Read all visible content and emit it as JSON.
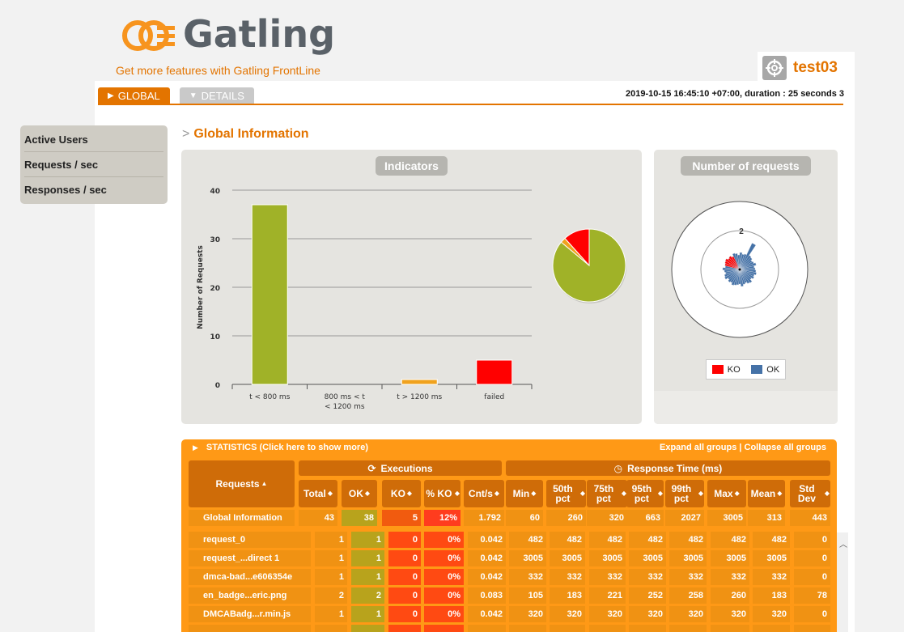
{
  "brand": {
    "name": "Gatling",
    "frontline_link": "Get more features with Gatling FrontLine"
  },
  "simulation": {
    "name": "test03",
    "icon": "crosshair-icon"
  },
  "tabs": [
    {
      "label": "GLOBAL",
      "active": true
    },
    {
      "label": "DETAILS",
      "active": false
    }
  ],
  "run_info": "2019-10-15 16:45:10 +07:00, duration : 25 seconds 3",
  "sidebar": {
    "items": [
      "Active Users",
      "Requests / sec",
      "Responses / sec"
    ]
  },
  "section_title": "Global Information",
  "indicators_panel": {
    "title": "Indicators"
  },
  "requests_panel": {
    "title": "Number of requests"
  },
  "chart_data": [
    {
      "type": "bar",
      "title": "Indicators",
      "ylabel": "Number of Requests",
      "categories": [
        "t < 800 ms",
        "800 ms < t < 1200 ms",
        "t > 1200 ms",
        "failed"
      ],
      "values": [
        37,
        0,
        1,
        5
      ],
      "colors": [
        "#a0b228",
        "#ffdd00",
        "#f0a21e",
        "#ff0000"
      ],
      "ylim": [
        0,
        40
      ],
      "yticks": [
        0,
        10,
        20,
        30,
        40
      ],
      "grid": true
    },
    {
      "type": "pie",
      "values": [
        37,
        1,
        5
      ],
      "colors": [
        "#a0b228",
        "#f0a21e",
        "#ff0000"
      ]
    },
    {
      "type": "pie",
      "title": "Number of requests",
      "annotation": "2",
      "legend": [
        {
          "name": "KO",
          "color": "#ff0000"
        },
        {
          "name": "OK",
          "color": "#4572a7"
        }
      ]
    }
  ],
  "statistics": {
    "toggle_label": "STATISTICS (Click here to show more)",
    "expand_label": "Expand all groups | Collapse all groups",
    "groups": {
      "executions": "Executions",
      "response_time": "Response Time (ms)"
    },
    "headers": {
      "requests": "Requests",
      "total": "Total",
      "ok": "OK",
      "ko": "KO",
      "pct_ko": "% KO",
      "cnt_s": "Cnt/s",
      "min": "Min",
      "p50": "50th pct",
      "p75": "75th pct",
      "p95": "95th pct",
      "p99": "99th pct",
      "max": "Max",
      "mean": "Mean",
      "std": "Std Dev"
    },
    "global": [
      "Global Information",
      "43",
      "38",
      "5",
      "12%",
      "1.792",
      "60",
      "260",
      "320",
      "663",
      "2027",
      "3005",
      "313",
      "443"
    ],
    "rows": [
      [
        "request_0",
        "1",
        "1",
        "0",
        "0%",
        "0.042",
        "482",
        "482",
        "482",
        "482",
        "482",
        "482",
        "482",
        "0"
      ],
      [
        "request_...direct 1",
        "1",
        "1",
        "0",
        "0%",
        "0.042",
        "3005",
        "3005",
        "3005",
        "3005",
        "3005",
        "3005",
        "3005",
        "0"
      ],
      [
        "dmca-bad...e606354e",
        "1",
        "1",
        "0",
        "0%",
        "0.042",
        "332",
        "332",
        "332",
        "332",
        "332",
        "332",
        "332",
        "0"
      ],
      [
        "en_badge...eric.png",
        "2",
        "2",
        "0",
        "0%",
        "0.083",
        "105",
        "183",
        "221",
        "252",
        "258",
        "260",
        "183",
        "78"
      ],
      [
        "DMCABadg...r.min.js",
        "1",
        "1",
        "0",
        "0%",
        "0.042",
        "320",
        "320",
        "320",
        "320",
        "320",
        "320",
        "320",
        "0"
      ]
    ]
  },
  "colors": {
    "accent": "#e37400",
    "ok": "#a0b228",
    "ko_cell": "#f15b0f",
    "pct_ko_cell": "#ff3c1e",
    "header": "#cf6c08",
    "row": "#f09213"
  }
}
